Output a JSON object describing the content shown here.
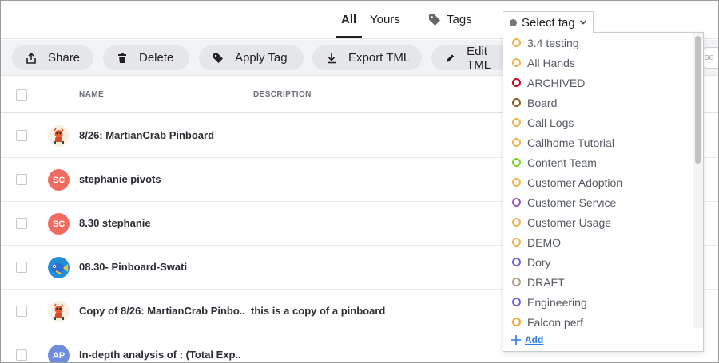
{
  "tabs": {
    "all": "All",
    "yours": "Yours",
    "tags": "Tags"
  },
  "tag_select": {
    "label": "Select tag"
  },
  "toolbar": {
    "share": "Share",
    "delete": "Delete",
    "apply_tag": "Apply Tag",
    "export_tml": "Export TML",
    "edit_tml": "Edit TML",
    "search_placeholder": "se"
  },
  "table": {
    "headers": {
      "name": "NAME",
      "description": "DESCRIPTION"
    },
    "rows": [
      {
        "avatar": "crab",
        "initials": "",
        "name": "8/26: MartianCrab Pinboard",
        "description": ""
      },
      {
        "avatar": "sc",
        "initials": "SC",
        "name": "stephanie pivots",
        "description": ""
      },
      {
        "avatar": "sc",
        "initials": "SC",
        "name": "8.30 stephanie",
        "description": ""
      },
      {
        "avatar": "fish",
        "initials": "",
        "name": "08.30- Pinboard-Swati",
        "description": ""
      },
      {
        "avatar": "crab",
        "initials": "",
        "name": "Copy of 8/26: MartianCrab Pinbo..",
        "description": "this is a copy of a pinboard"
      },
      {
        "avatar": "ap",
        "initials": "AP",
        "name": "In-depth analysis of : (Total Exp..",
        "description": ""
      }
    ]
  },
  "dropdown": {
    "items": [
      {
        "label": "3.4 testing",
        "color": "#f0b24a"
      },
      {
        "label": "All Hands",
        "color": "#f0b24a"
      },
      {
        "label": "ARCHIVED",
        "color": "#d0021b"
      },
      {
        "label": "Board",
        "color": "#8b5a1e"
      },
      {
        "label": "Call Logs",
        "color": "#f0b24a"
      },
      {
        "label": "Callhome Tutorial",
        "color": "#f0b24a"
      },
      {
        "label": "Content Team",
        "color": "#7ed321"
      },
      {
        "label": "Customer Adoption",
        "color": "#f0b24a"
      },
      {
        "label": "Customer Service",
        "color": "#9b59b6"
      },
      {
        "label": "Customer Usage",
        "color": "#f0b24a"
      },
      {
        "label": "DEMO",
        "color": "#f0b24a"
      },
      {
        "label": "Dory",
        "color": "#6c63e6"
      },
      {
        "label": "DRAFT",
        "color": "#b89b82"
      },
      {
        "label": "Engineering",
        "color": "#6c63e6"
      },
      {
        "label": "Falcon perf",
        "color": "#f5a623"
      }
    ],
    "add_label": "Add"
  }
}
